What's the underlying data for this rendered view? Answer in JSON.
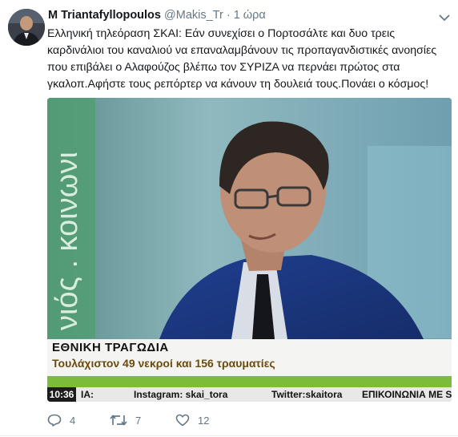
{
  "tweet": {
    "author_name": "M Triantafyllopoulos",
    "handle": "@Makis_Tr",
    "separator": "·",
    "time": "1 ώρα",
    "text": "Ελληνική τηλεόραση ΣΚΑΙ: Εάν  συνεχίσει ο Πορτοσάλτε και δυο τρεις καρδινάλιοι του καναλιού να επαναλαμβάνουν τις προπαγανδιστικές ανοησίες που επιβάλει ο Αλαφούζος βλέπω τον ΣΥΡΙΖΑ να περνάει πρώτος στα γκαλοπ.Αφήστε τους ρεπόρτερ να κάνουν τη δουλειά τους.Πονάει ο κόσμος!"
  },
  "media": {
    "vertical_text": "νιός . κοινωνι",
    "lower_third_title": "ΕΘΝΙΚΗ ΤΡΑΓΩΔΙΑ",
    "lower_third_subtitle": "Τουλάχιστον 49 νεκροί και 156 τραυματίες",
    "clock": "10:36",
    "ticker_left": "ΙΑ:",
    "ticker_instagram": "Instagram: skai_tora",
    "ticker_twitter": "Twitter:skaitora",
    "ticker_contact": "ΕΠΙΚΟΙΝΩΝΙΑ ΜΕ SM"
  },
  "actions": {
    "replies": "4",
    "retweets": "7",
    "likes": "12"
  },
  "colors": {
    "name": "#14171a",
    "secondary": "#657786",
    "tv_background": "#7aa3a8",
    "lower_third_sub": "#6a4b10"
  },
  "icons": [
    "caret-down-icon",
    "reply-icon",
    "retweet-icon",
    "like-icon"
  ]
}
